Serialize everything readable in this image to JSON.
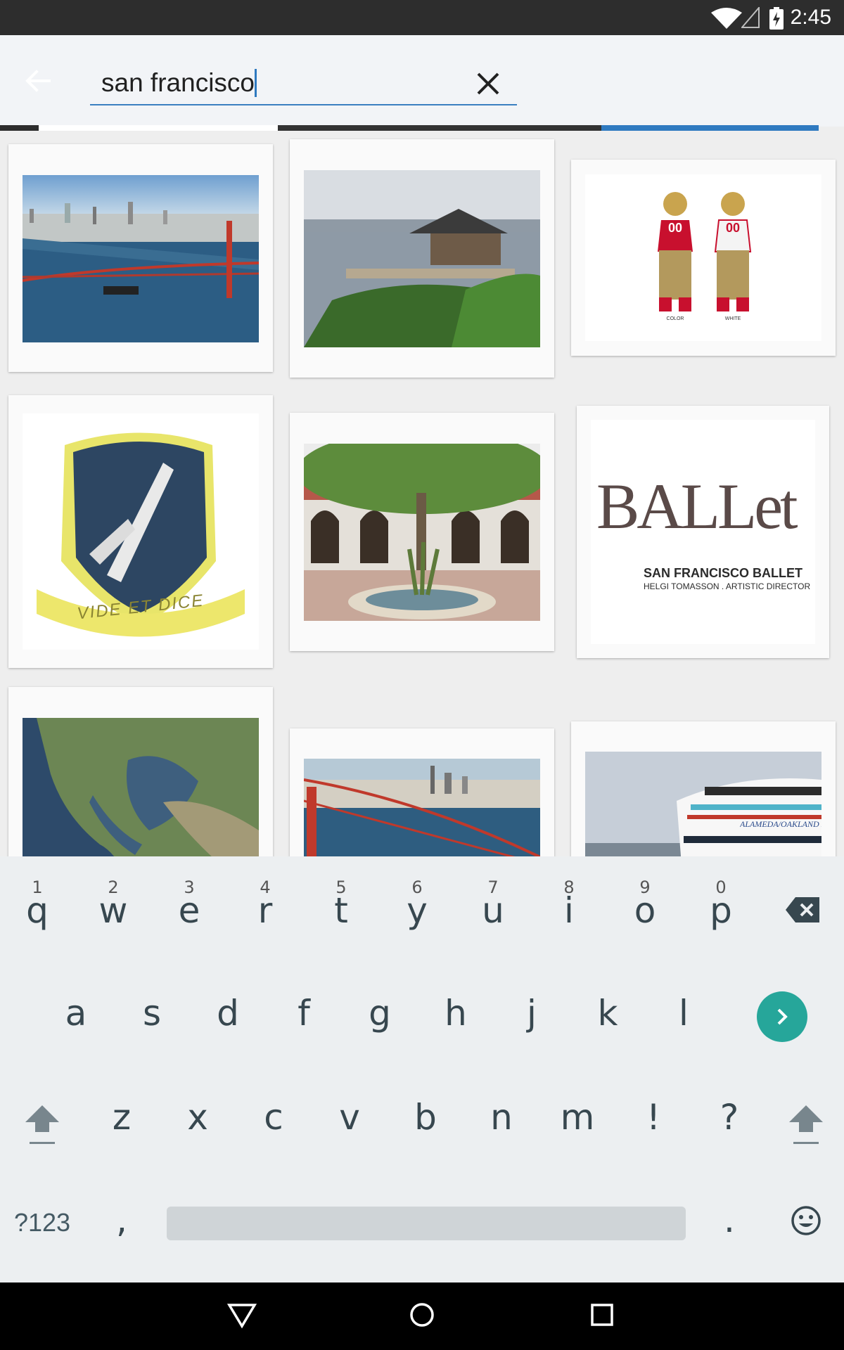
{
  "status_bar": {
    "time": "2:45",
    "wifi_icon": "wifi-icon",
    "signal_icon": "signal-icon",
    "battery_icon": "battery-charging-icon"
  },
  "search": {
    "query": "san francisco",
    "back_icon": "arrow-back-icon",
    "clear_icon": "close-icon"
  },
  "results": [
    {
      "label": "Golden Gate Bridge aerial view"
    },
    {
      "label": "Gazebo overlooking the bay"
    },
    {
      "label": "49ers uniforms",
      "captions": [
        "COLOR",
        "WHITE"
      ],
      "jersey_number": "00"
    },
    {
      "label": "Embroidered patch",
      "motto": "VIDE ET DICE"
    },
    {
      "label": "Mission courtyard with fountain"
    },
    {
      "label": "San Francisco Ballet logo",
      "logo_text": "BALLet",
      "title": "SAN FRANCISCO BALLET",
      "subtitle": "HELGI TOMASSON . ARTISTIC DIRECTOR"
    },
    {
      "label": "Satellite map of the bay area"
    },
    {
      "label": "City skyline from bridge"
    },
    {
      "label": "Ferry boat",
      "boat_text": "ALAMEDA/OAKLAND FERRY"
    }
  ],
  "keyboard": {
    "row1": [
      "q",
      "w",
      "e",
      "r",
      "t",
      "y",
      "u",
      "i",
      "o",
      "p"
    ],
    "row1_hints": [
      "1",
      "2",
      "3",
      "4",
      "5",
      "6",
      "7",
      "8",
      "9",
      "0"
    ],
    "row2": [
      "a",
      "s",
      "d",
      "f",
      "g",
      "h",
      "j",
      "k",
      "l"
    ],
    "row3": [
      "z",
      "x",
      "c",
      "v",
      "b",
      "n",
      "m",
      "!",
      "?"
    ],
    "symbols_key": "?123",
    "comma_key": ",",
    "period_key": ".",
    "backspace_icon": "backspace-icon",
    "enter_icon": "go-arrow-icon",
    "shift_icon": "shift-icon",
    "emoji_icon": "emoji-icon"
  },
  "navbar": {
    "back_icon": "nav-back-icon",
    "home_icon": "nav-home-icon",
    "recents_icon": "nav-recents-icon"
  },
  "colors": {
    "accent": "#2f7ac0",
    "go_button": "#26a69a",
    "status_bar": "#2d2d2d"
  }
}
